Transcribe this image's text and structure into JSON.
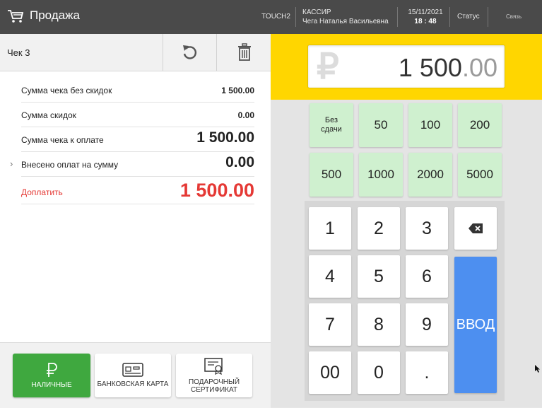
{
  "header": {
    "title": "Продажа",
    "terminal": "TOUCH2",
    "cashier_role": "КАССИР",
    "cashier_name": "Чега Наталья Васильевна",
    "date": "15/11/2021",
    "time": "18 : 48",
    "status_label": "Статус",
    "link_label": "Связь"
  },
  "receipt": {
    "name": "Чек 3",
    "rows": [
      {
        "label": "Сумма чека без скидок",
        "value": "1 500.00"
      },
      {
        "label": "Сумма скидок",
        "value": "0.00"
      },
      {
        "label": "Сумма чека к оплате",
        "value": "1 500.00"
      },
      {
        "label": "Внесено оплат на сумму",
        "value": "0.00"
      },
      {
        "label": "Доплатить",
        "value": "1 500.00"
      }
    ]
  },
  "payment_types": {
    "cash": "НАЛИЧНЫЕ",
    "card": "БАНКОВСКАЯ КАРТА",
    "gift_line1": "ПОДАРОЧНЫЙ",
    "gift_line2": "СЕРТИФИКАТ"
  },
  "amount": {
    "integer": "1 500",
    "decimal": ".00",
    "currency_symbol": "₽"
  },
  "quick_amounts": {
    "no_change_line1": "Без",
    "no_change_line2": "сдачи",
    "values": [
      "50",
      "100",
      "200",
      "500",
      "1000",
      "2000",
      "5000"
    ]
  },
  "keypad": {
    "keys": [
      "1",
      "2",
      "3",
      "4",
      "5",
      "6",
      "7",
      "8",
      "9",
      "00",
      "0",
      "."
    ],
    "enter": "ВВОД"
  },
  "colors": {
    "accent_yellow": "#ffd600",
    "cash_green": "#3fa83f",
    "enter_blue": "#4d8ff0",
    "due_red": "#e53935"
  }
}
